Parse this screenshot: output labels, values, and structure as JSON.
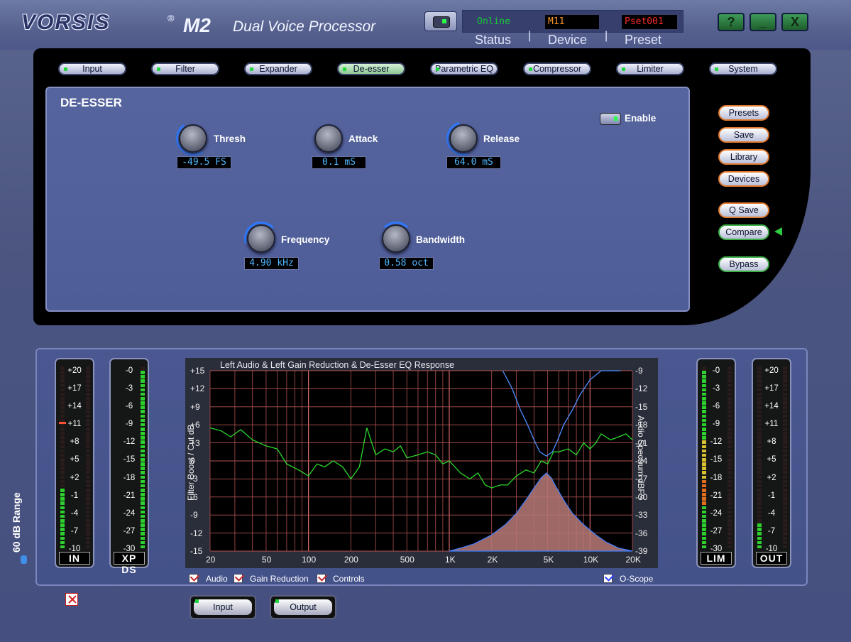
{
  "header": {
    "logo": "VORSIS",
    "registered": "®",
    "model": "M2",
    "subtitle": "Dual Voice Processor",
    "status_value": "Online",
    "device_value": "M11",
    "preset_value": "Pset001",
    "status_label": "Status",
    "device_label": "Device",
    "preset_label": "Preset",
    "separator": "|",
    "help_label": "?",
    "minimize_label": "_",
    "close_label": "X"
  },
  "tabs": [
    {
      "label": "Input",
      "active": false
    },
    {
      "label": "Filter",
      "active": false
    },
    {
      "label": "Expander",
      "active": false
    },
    {
      "label": "De-esser",
      "active": true
    },
    {
      "label": "Parametric EQ",
      "active": false
    },
    {
      "label": "Compressor",
      "active": false
    },
    {
      "label": "Limiter",
      "active": false
    },
    {
      "label": "System",
      "active": false
    }
  ],
  "deesser": {
    "title": "DE-ESSER",
    "enable_label": "Enable",
    "thresh_label": "Thresh",
    "thresh_value": "-49.5 FS",
    "attack_label": "Attack",
    "attack_value": "0.1 mS",
    "release_label": "Release",
    "release_value": "64.0 mS",
    "frequency_label": "Frequency",
    "frequency_value": "4.90 kHz",
    "bandwidth_label": "Bandwidth",
    "bandwidth_value": "0.58 oct"
  },
  "side_buttons": {
    "presets": "Presets",
    "save": "Save",
    "library": "Library",
    "devices": "Devices",
    "qsave": "Q Save",
    "compare": "Compare",
    "bypass": "Bypass"
  },
  "meters": {
    "range_label": "60 dB Range",
    "in_label": "IN",
    "xpds_label": "XP DS",
    "lim_label": "LIM",
    "out_label": "OUT",
    "scale_20": [
      "+20",
      "+17",
      "+14",
      "+11",
      "+8",
      "+5",
      "+2",
      "-1",
      "-4",
      "-7",
      "-10"
    ],
    "scale_0": [
      "-0",
      "-3",
      "-6",
      "-9",
      "-12",
      "-15",
      "-18",
      "-21",
      "-24",
      "-27",
      "-30"
    ]
  },
  "chart_data": {
    "type": "line",
    "title": "Left Audio & Left Gain Reduction & De-Esser EQ Response",
    "ylabel": "Filter Boost / Cut dB",
    "ylabel_right": "Audio Spectrum dBFS",
    "x_scale": "log",
    "xlim": [
      20,
      20000
    ],
    "ylim": [
      -15,
      15
    ],
    "ylim_right": [
      -39,
      -9
    ],
    "x_ticks": [
      "20",
      "50",
      "100",
      "200",
      "500",
      "1K",
      "2K",
      "5K",
      "10K",
      "20K"
    ],
    "y_ticks": [
      "+15",
      "+12",
      "+9",
      "+6",
      "+3",
      "0",
      "-3",
      "-6",
      "-9",
      "-12",
      "-15"
    ],
    "y_ticks_right": [
      "-9",
      "-12",
      "-15",
      "-18",
      "-21",
      "-24",
      "-27",
      "-30",
      "-33",
      "-36",
      "-39"
    ],
    "series": [
      {
        "color": "#2ad82a",
        "axis": "right",
        "x": [
          20,
          24,
          28,
          33,
          40,
          50,
          60,
          70,
          85,
          100,
          115,
          130,
          150,
          175,
          200,
          230,
          260,
          300,
          350,
          400,
          450,
          500,
          600,
          700,
          800,
          900,
          1000,
          1200,
          1400,
          1600,
          1800,
          2000,
          2300,
          2600,
          3000,
          3500,
          4000,
          4500,
          5000,
          5500,
          6000,
          7000,
          8000,
          9000,
          10000,
          11000,
          12000,
          14000,
          16000,
          18000,
          20000
        ],
        "y": [
          -18.5,
          -19,
          -20,
          -18.8,
          -20.5,
          -21.5,
          -22,
          -24.5,
          -25.5,
          -26.5,
          -24.5,
          -25,
          -24,
          -25,
          -27,
          -25,
          -18.5,
          -23,
          -22,
          -22.5,
          -21.5,
          -23.5,
          -23,
          -22.5,
          -23,
          -24.5,
          -24,
          -26,
          -27,
          -26,
          -28,
          -28.5,
          -28,
          -28,
          -26.5,
          -25.5,
          -26,
          -24,
          -24.5,
          -22.5,
          -22.5,
          -22,
          -23,
          -21,
          -22,
          -21,
          -19.5,
          -20.5,
          -20,
          -19.5,
          -20.5
        ]
      },
      {
        "color": "#3f7fff",
        "axis": "left",
        "x": [
          1000,
          1200,
          1500,
          2000,
          2500,
          3000,
          3500,
          4000,
          4500,
          4900,
          5300,
          5800,
          6500,
          7500,
          9000,
          11000,
          13000,
          16000,
          20000
        ],
        "y": [
          -15,
          -14.5,
          -13.8,
          -12.3,
          -10.6,
          -8.7,
          -6.5,
          -4.5,
          -2.8,
          -2.0,
          -2.8,
          -4.5,
          -6.5,
          -8.7,
          -10.6,
          -12.3,
          -13.5,
          -14.5,
          -15
        ]
      },
      {
        "color": "#4f8fff",
        "axis": "left",
        "x": [
          2400,
          2800,
          3200,
          3600,
          4000,
          4400,
          4900,
          5400,
          5900,
          6500,
          7500,
          8500,
          10000,
          12000,
          14000,
          16500
        ],
        "y": [
          15,
          12,
          8.5,
          6,
          3.5,
          1.5,
          0.8,
          1.5,
          3.5,
          6,
          8.5,
          11,
          13.5,
          15,
          15,
          15
        ]
      }
    ]
  },
  "checkboxes": {
    "audio": "Audio",
    "gain_reduction": "Gain Reduction",
    "controls": "Controls",
    "oscope": "O-Scope"
  },
  "bottom_buttons": {
    "input": "Input",
    "output": "Output"
  }
}
